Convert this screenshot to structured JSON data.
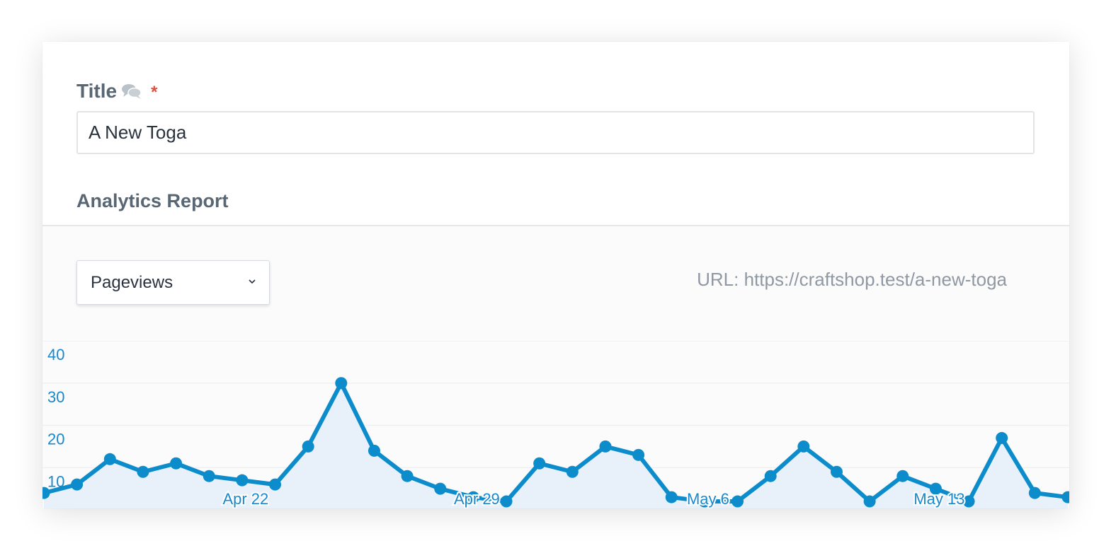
{
  "form": {
    "title_label": "Title",
    "required_marker": "*",
    "title_value": "A New Toga",
    "translatable_icon": "chat-bubbles-icon"
  },
  "analytics": {
    "heading": "Analytics Report",
    "metric_selected": "Pageviews",
    "url_label": "URL:",
    "url_value": "https://craftshop.test/a-new-toga"
  },
  "colors": {
    "line": "#0d8ccc",
    "area": "#e8f1f9",
    "axis_text": "#1a88cc",
    "label_gray": "#596673",
    "required": "#d9523f"
  },
  "chart_data": {
    "type": "area",
    "ylim": [
      0,
      40
    ],
    "yticks": [
      10,
      20,
      30,
      40
    ],
    "grid": true,
    "x": [
      "Apr 16",
      "Apr 17",
      "Apr 18",
      "Apr 19",
      "Apr 20",
      "Apr 21",
      "Apr 22",
      "Apr 23",
      "Apr 24",
      "Apr 25",
      "Apr 26",
      "Apr 27",
      "Apr 28",
      "Apr 29",
      "Apr 30",
      "May 1",
      "May 2",
      "May 3",
      "May 4",
      "May 5",
      "May 6",
      "May 7",
      "May 8",
      "May 9",
      "May 10",
      "May 11",
      "May 12",
      "May 13",
      "May 14",
      "May 15",
      "May 16",
      "May 17"
    ],
    "xtick_labels": [
      "Apr 22",
      "Apr 29",
      "May 6",
      "May 13"
    ],
    "series": [
      {
        "values": [
          4,
          6,
          12,
          9,
          11,
          8,
          7,
          6,
          15,
          30,
          14,
          8,
          5,
          3,
          2,
          11,
          9,
          15,
          13,
          3,
          2,
          2,
          8,
          15,
          9,
          2,
          8,
          5,
          2,
          17,
          4,
          3
        ]
      }
    ]
  }
}
